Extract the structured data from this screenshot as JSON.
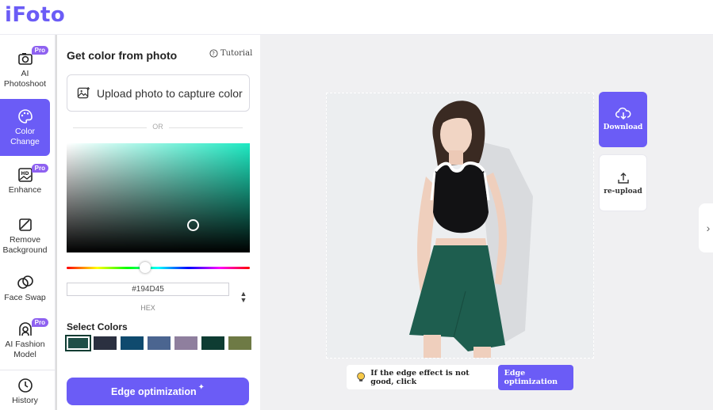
{
  "app": {
    "logo": "iFoto"
  },
  "sidebar": {
    "items": [
      {
        "label": "AI Photoshoot",
        "badge": "Pro",
        "icon": "camera-icon",
        "active": false
      },
      {
        "label": "Color Change",
        "badge": "",
        "icon": "palette-icon",
        "active": true
      },
      {
        "label": "Enhance",
        "badge": "Pro",
        "icon": "hd-image-icon",
        "active": false
      },
      {
        "label": "Remove Background",
        "badge": "",
        "icon": "eraser-icon",
        "active": false
      },
      {
        "label": "Face Swap",
        "badge": "",
        "icon": "face-swap-icon",
        "active": false
      },
      {
        "label": "AI Fashion Model",
        "badge": "Pro",
        "icon": "fashion-model-icon",
        "active": false
      },
      {
        "label": "History",
        "badge": "",
        "icon": "clock-icon",
        "active": false
      }
    ]
  },
  "panel": {
    "title": "Get color from photo",
    "tutorial": "Tutorial",
    "upload_label": "Upload photo to capture color",
    "or_label": "OR",
    "hex_value": "#194D45",
    "hex_label": "HEX",
    "select_colors_title": "Select Colors",
    "swatches": [
      "#1f4f47",
      "#2b3040",
      "#0f4a6e",
      "#4b6590",
      "#8f7f9e",
      "#0e3c32",
      "#6e7a45"
    ],
    "edge_button": "Edge optimization",
    "accent_color": "#6b5cf6"
  },
  "canvas": {
    "download_label": "Download",
    "reupload_label": "re-upload",
    "tip_text": "If the edge effect is not good, click",
    "tip_button": "Edge optimization",
    "skirt_color": "#1e5e4f"
  }
}
